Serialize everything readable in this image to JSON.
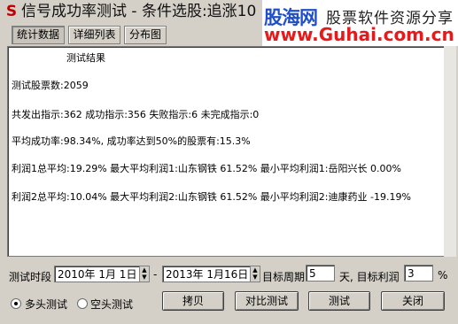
{
  "window": {
    "title": "信号成功率测试 - 条件选股:追涨10",
    "icon": "S"
  },
  "watermark": {
    "brand": "股海网",
    "slogan": "股票软件资源分享",
    "url": "www.Guhai.com.cn"
  },
  "tabs": [
    {
      "label": "统计数据"
    },
    {
      "label": "详细列表"
    },
    {
      "label": "分布图"
    }
  ],
  "results": {
    "heading": "测试结果",
    "lines": [
      "测试股票数:2059",
      "共发出指示:362 成功指示:356 失败指示:6 未完成指示:0",
      "平均成功率:98.34%, 成功率达到50%的股票有:15.3%",
      "利润1总平均:19.29% 最大平均利润1:山东钢铁 61.52% 最小平均利润1:岳阳兴长 0.00%",
      "利润2总平均:10.04% 最大平均利润2:山东钢铁 61.52% 最小平均利润2:迪康药业 -19.19%"
    ]
  },
  "controls": {
    "period_label": "测试时段",
    "start_date": "2010年 1月 1日",
    "dash": "-",
    "end_date": "2013年 1月16日",
    "target_period_label": "目标周期",
    "target_period_value": "5",
    "days_target_profit_label": "天, 目标利润",
    "target_profit_value": "3",
    "percent": "%",
    "radio_long": "多头测试",
    "radio_short": "空头测试",
    "radio_long_checked": true
  },
  "buttons": {
    "copy": "拷贝",
    "compare": "对比测试",
    "test": "测试",
    "close": "关闭"
  }
}
